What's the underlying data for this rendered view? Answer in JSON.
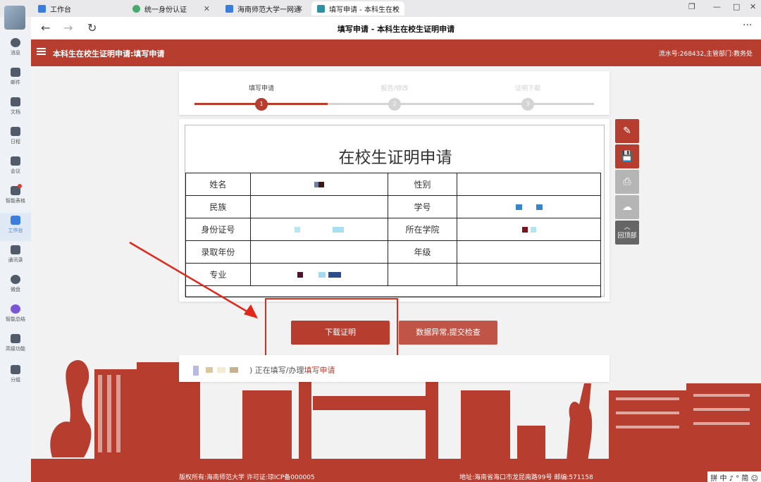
{
  "browser": {
    "tabs": [
      {
        "label": "工作台",
        "color": "#3b7ddd"
      },
      {
        "label": "统一身份认证",
        "color": "#4aa96c"
      },
      {
        "label": "海南师范大学一网通",
        "color": "#3b7ddd"
      },
      {
        "label": "填写申请 - 本科生在校",
        "color": "#2f8fa3"
      }
    ],
    "page_title": "填写申请 - 本科生在校生证明申请",
    "more_glyph": "···"
  },
  "sidebar": {
    "items": [
      {
        "label": "消息",
        "icon": "chat-icon"
      },
      {
        "label": "邮件",
        "icon": "mail-icon"
      },
      {
        "label": "文档",
        "icon": "document-icon"
      },
      {
        "label": "日程",
        "icon": "calendar-icon"
      },
      {
        "label": "会议",
        "icon": "meeting-icon"
      },
      {
        "label": "智能表格",
        "icon": "sheet-icon"
      },
      {
        "label": "工作台",
        "icon": "grid-icon"
      },
      {
        "label": "通讯录",
        "icon": "contacts-icon"
      },
      {
        "label": "微盘",
        "icon": "disk-icon"
      },
      {
        "label": "智能总结",
        "icon": "summary-icon"
      },
      {
        "label": "高级功能",
        "icon": "advanced-icon"
      },
      {
        "label": "分组",
        "icon": "tag-icon"
      }
    ]
  },
  "header": {
    "title": "本科生在校生证明申请:填写申请",
    "serial": "流水号:268432,主管部门:教务处"
  },
  "steps": [
    {
      "label": "填写申请",
      "num": "1",
      "active": true
    },
    {
      "label": "报告/修改",
      "num": "2",
      "active": false
    },
    {
      "label": "证明下载",
      "num": "3",
      "active": false
    }
  ],
  "form": {
    "title": "在校生证明申请",
    "rows": [
      [
        "姓名",
        "",
        "性别",
        ""
      ],
      [
        "民族",
        "",
        "学号",
        ""
      ],
      [
        "身份证号",
        "",
        "所在学院",
        ""
      ],
      [
        "录取年份",
        "",
        "年级",
        ""
      ],
      [
        "专业",
        "",
        "",
        ""
      ]
    ]
  },
  "tools": [
    {
      "name": "edit-icon",
      "glyph": "✎"
    },
    {
      "name": "save-icon",
      "glyph": "💾"
    },
    {
      "name": "print-icon",
      "glyph": "⎙"
    },
    {
      "name": "cloud-download-icon",
      "glyph": "☁"
    },
    {
      "name": "back-to-top",
      "glyph": "︿",
      "label": "回顶部"
    }
  ],
  "actions": {
    "download": "下载证明",
    "report": "数据异常,提交检查"
  },
  "status": {
    "prefix": ")  正在填写/办理",
    "highlight": "填写申请"
  },
  "footer": {
    "left": "版权所有:海南师范大学 许可证:琼ICP备000005",
    "right": "地址:海南省海口市龙昆南路99号 邮编:571158",
    "ime": "拼 中 ♪ ° 简 ☺"
  },
  "colors": {
    "brand": "#b73d2f",
    "annotation": "#e0281d"
  }
}
